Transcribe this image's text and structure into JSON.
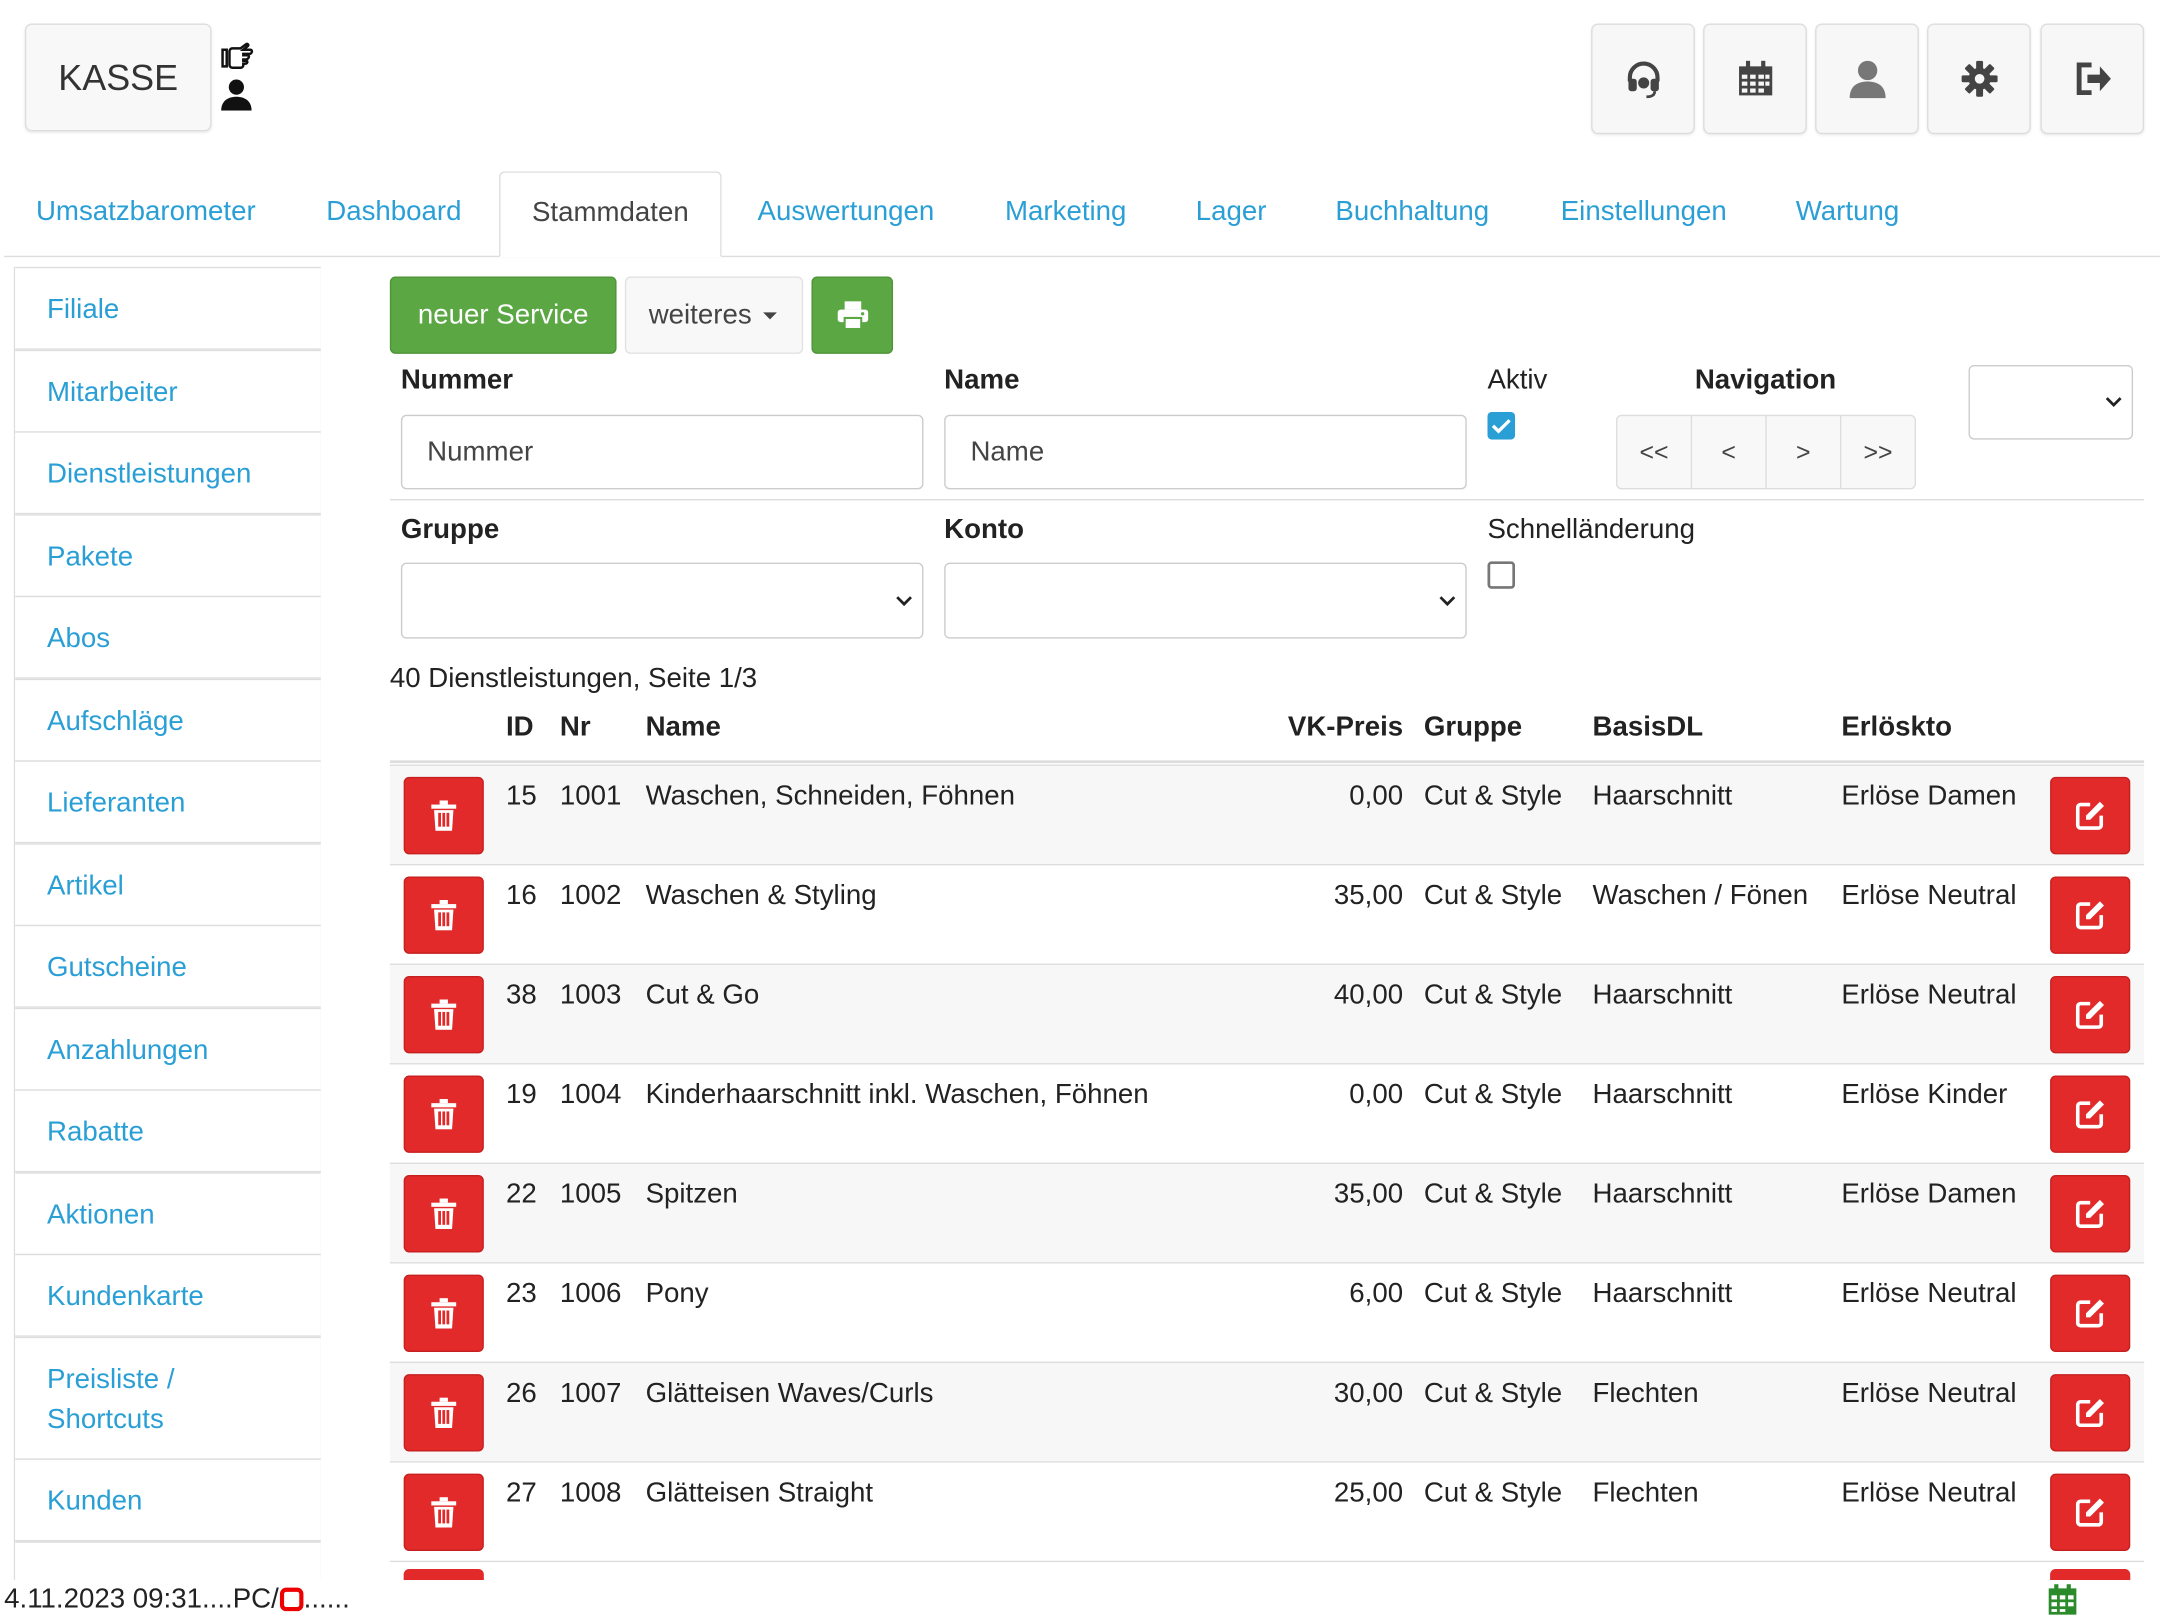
{
  "header": {
    "kasse_label": "KASSE"
  },
  "top_buttons": [
    {
      "name": "support-headset-icon"
    },
    {
      "name": "calendar-icon"
    },
    {
      "name": "user-icon"
    },
    {
      "name": "gear-icon"
    },
    {
      "name": "logout-icon"
    }
  ],
  "tabs": [
    {
      "label": "Umsatzbarometer"
    },
    {
      "label": "Dashboard"
    },
    {
      "label": "Stammdaten",
      "active": true
    },
    {
      "label": "Auswertungen"
    },
    {
      "label": "Marketing"
    },
    {
      "label": "Lager"
    },
    {
      "label": "Buchhaltung"
    },
    {
      "label": "Einstellungen"
    },
    {
      "label": "Wartung"
    }
  ],
  "sidebar": {
    "items": [
      {
        "label": "Filiale"
      },
      {
        "label": "Mitarbeiter"
      },
      {
        "label": "Dienstleistungen"
      },
      {
        "label": "Pakete"
      },
      {
        "label": "Abos"
      },
      {
        "label": "Aufschläge"
      },
      {
        "label": "Lieferanten"
      },
      {
        "label": "Artikel"
      },
      {
        "label": "Gutscheine"
      },
      {
        "label": "Anzahlungen"
      },
      {
        "label": "Rabatte"
      },
      {
        "label": "Aktionen"
      },
      {
        "label": "Kundenkarte"
      },
      {
        "label": "Preisliste / Shortcuts"
      },
      {
        "label": "Kunden"
      }
    ]
  },
  "toolbar": {
    "new_label": "neuer Service",
    "more_label": "weiteres"
  },
  "filters": {
    "nummer_label": "Nummer",
    "nummer_placeholder": "Nummer",
    "name_label": "Name",
    "name_placeholder": "Name",
    "aktiv_label": "Aktiv",
    "aktiv_checked": true,
    "navigation_label": "Navigation",
    "nav": [
      "<<",
      "<",
      ">",
      ">>"
    ],
    "gruppe_label": "Gruppe",
    "konto_label": "Konto",
    "schnell_label": "Schnelländerung",
    "schnell_checked": false
  },
  "table": {
    "summary": "40 Dienstleistungen, Seite 1/3",
    "headers": {
      "id": "ID",
      "nr": "Nr",
      "name": "Name",
      "price": "VK-Preis",
      "group": "Gruppe",
      "basis": "BasisDL",
      "account": "Erlöskto"
    },
    "rows": [
      {
        "id": "15",
        "nr": "1001",
        "name": "Waschen, Schneiden, Föhnen",
        "price": "0,00",
        "group": "Cut & Style",
        "basis": "Haarschnitt",
        "account": "Erlöse Damen"
      },
      {
        "id": "16",
        "nr": "1002",
        "name": "Waschen & Styling",
        "price": "35,00",
        "group": "Cut & Style",
        "basis": "Waschen / Fönen",
        "account": "Erlöse Neutral"
      },
      {
        "id": "38",
        "nr": "1003",
        "name": "Cut & Go",
        "price": "40,00",
        "group": "Cut & Style",
        "basis": "Haarschnitt",
        "account": "Erlöse Neutral"
      },
      {
        "id": "19",
        "nr": "1004",
        "name": "Kinderhaarschnitt inkl. Waschen, Föhnen",
        "price": "0,00",
        "group": "Cut & Style",
        "basis": "Haarschnitt",
        "account": "Erlöse Kinder"
      },
      {
        "id": "22",
        "nr": "1005",
        "name": "Spitzen",
        "price": "35,00",
        "group": "Cut & Style",
        "basis": "Haarschnitt",
        "account": "Erlöse Damen"
      },
      {
        "id": "23",
        "nr": "1006",
        "name": "Pony",
        "price": "6,00",
        "group": "Cut & Style",
        "basis": "Haarschnitt",
        "account": "Erlöse Neutral"
      },
      {
        "id": "26",
        "nr": "1007",
        "name": "Glätteisen Waves/Curls",
        "price": "30,00",
        "group": "Cut & Style",
        "basis": "Flechten",
        "account": "Erlöse Neutral"
      },
      {
        "id": "27",
        "nr": "1008",
        "name": "Glätteisen Straight",
        "price": "25,00",
        "group": "Cut & Style",
        "basis": "Flechten",
        "account": "Erlöse Neutral"
      }
    ]
  },
  "status": {
    "prefix": "4.11.2023 09:31....PC/",
    "suffix": "......"
  },
  "colors": {
    "link": "#2a9fd6",
    "green": "#5ba744",
    "red": "#e22a2a"
  }
}
